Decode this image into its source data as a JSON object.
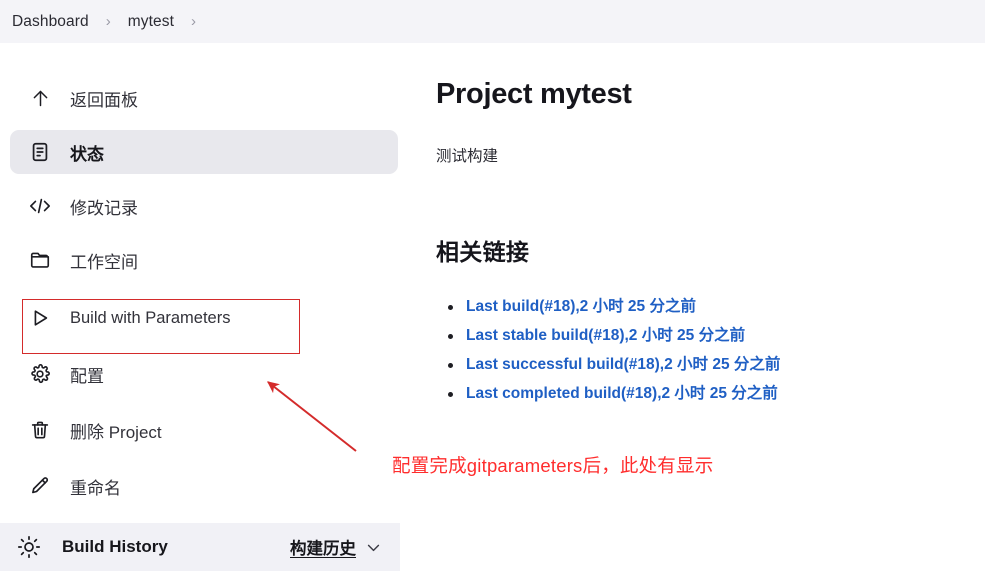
{
  "breadcrumb": {
    "items": [
      "Dashboard",
      "mytest"
    ],
    "separator": "›"
  },
  "sidebar": {
    "items": [
      {
        "icon": "arrow-up-icon",
        "label": "返回面板",
        "name": "back-to-dashboard",
        "active": false
      },
      {
        "icon": "document-icon",
        "label": "状态",
        "name": "status",
        "active": true
      },
      {
        "icon": "code-icon",
        "label": "修改记录",
        "name": "changes",
        "active": false
      },
      {
        "icon": "folder-icon",
        "label": "工作空间",
        "name": "workspace",
        "active": false
      },
      {
        "icon": "play-icon",
        "label": "Build with Parameters",
        "name": "build-with-parameters",
        "active": false
      },
      {
        "icon": "gear-icon",
        "label": "配置",
        "name": "configure",
        "active": false
      },
      {
        "icon": "trash-icon",
        "label": "删除 Project",
        "name": "delete-project",
        "active": false
      },
      {
        "icon": "pencil-icon",
        "label": "重命名",
        "name": "rename",
        "active": false
      }
    ]
  },
  "build_history": {
    "icon": "weather-sun-icon",
    "title": "Build History",
    "link_label": "构建历史",
    "chevron": "chevron-down-icon"
  },
  "main": {
    "title": "Project mytest",
    "description": "测试构建",
    "section_title": "相关链接",
    "links": [
      "Last build(#18),2 小时 25 分之前",
      "Last stable build(#18),2 小时 25 分之前",
      "Last successful build(#18),2 小时 25 分之前",
      "Last completed build(#18),2 小时 25 分之前"
    ]
  },
  "annotations": {
    "note_text": "配置完成gitparameters后，此处有显示",
    "highlight_color": "#d42b2b",
    "note_color": "#ff2d2d"
  },
  "colors": {
    "link": "#1f5fc4",
    "topbar_bg": "#f4f4f8",
    "active_item_bg": "#e8e8ed",
    "footer_bg": "#f1f1f6"
  }
}
